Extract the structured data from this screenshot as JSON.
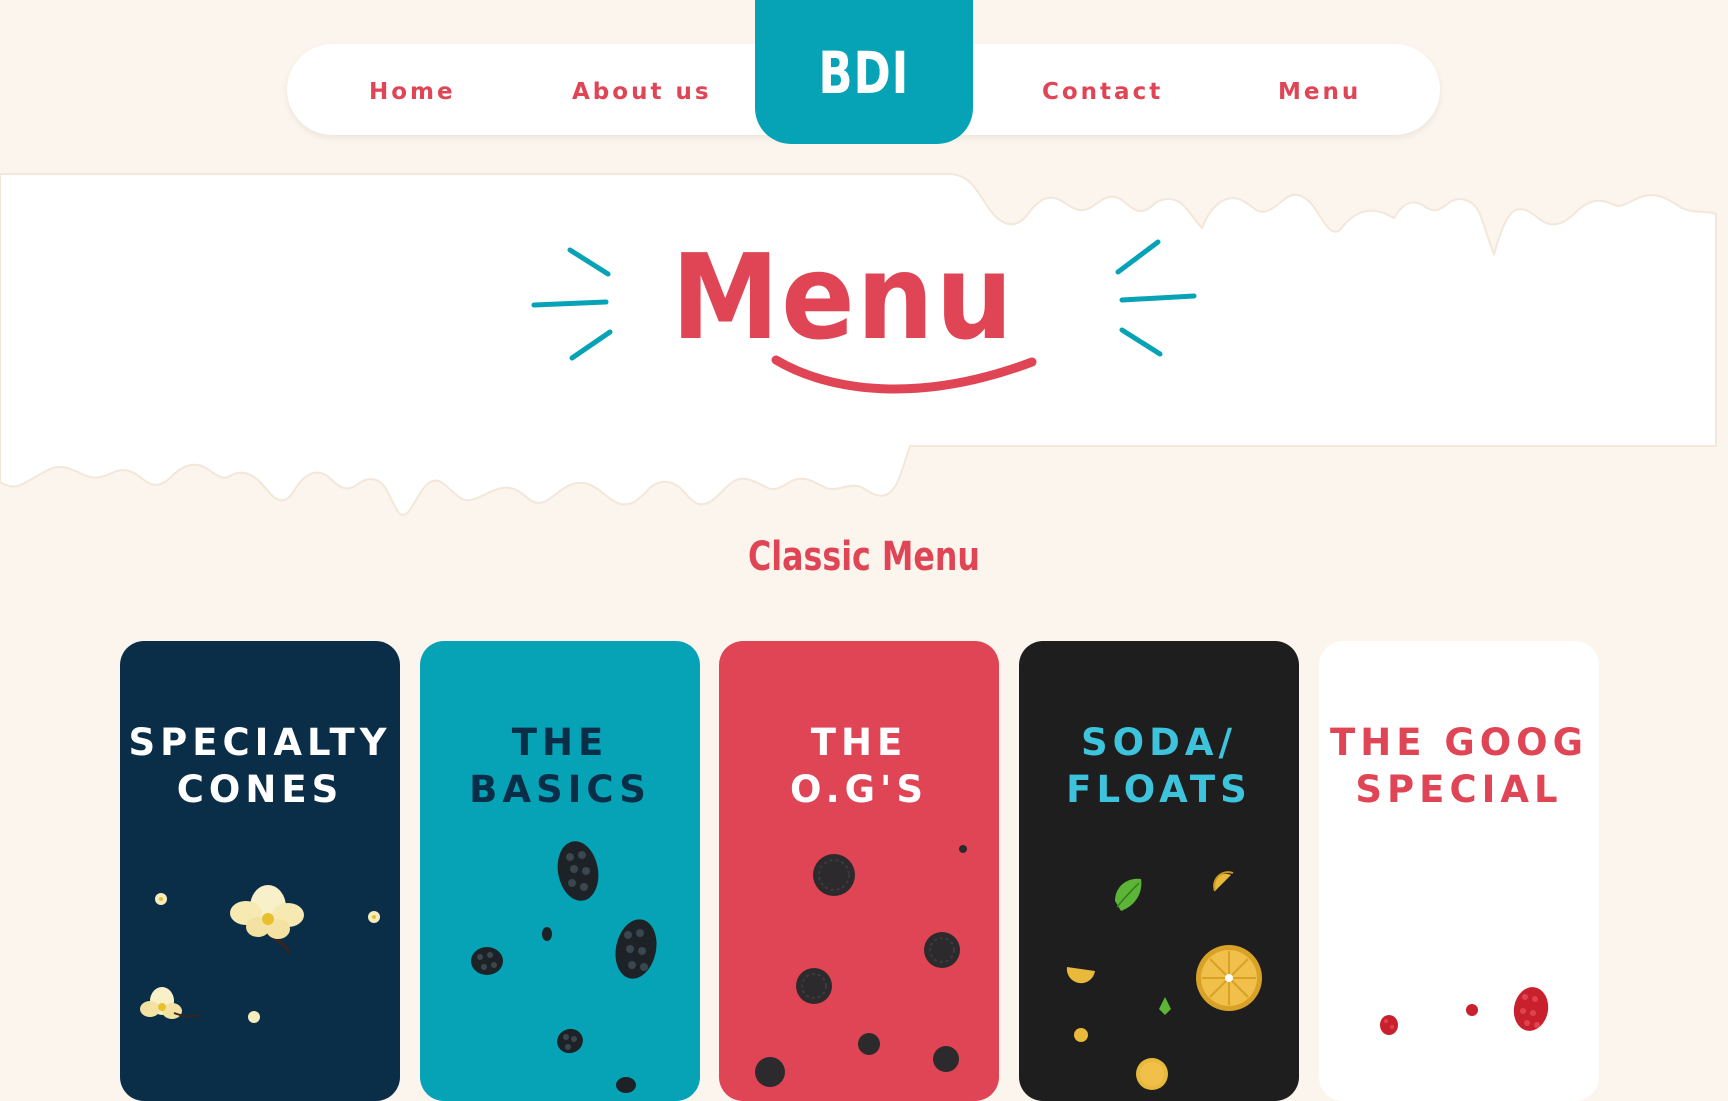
{
  "nav": {
    "items": [
      {
        "label": "Home"
      },
      {
        "label": "About us"
      },
      {
        "label": "Contact"
      },
      {
        "label": "Menu"
      }
    ],
    "logo": "BDI"
  },
  "hero": {
    "title": "Menu"
  },
  "section": {
    "title": "Classic Menu"
  },
  "cards": [
    {
      "title": "SPECIALTY\nCONES",
      "bg": "#0a2d48",
      "fg": "#ffffff",
      "decor": "vanilla-flower-icons"
    },
    {
      "title": "THE\nBASICS",
      "bg": "#06a3b7",
      "fg": "#0a2d48",
      "decor": "blackberry-icons"
    },
    {
      "title": "THE\nO.G'S",
      "bg": "#e04555",
      "fg": "#ffffff",
      "decor": "cookie-icons"
    },
    {
      "title": "SODA/\nFLOATS",
      "bg": "#1e1e1e",
      "fg": "#3ec3dc",
      "decor": "citrus-mint-icons"
    },
    {
      "title": "THE GOOG\nSPECIAL",
      "bg": "#ffffff",
      "fg": "#e04555",
      "decor": "raspberry-icons"
    }
  ],
  "colors": {
    "accent_red": "#e04555",
    "accent_teal": "#06a3b7",
    "cream_bg": "#fbf5ee",
    "navy": "#0a2d48"
  }
}
